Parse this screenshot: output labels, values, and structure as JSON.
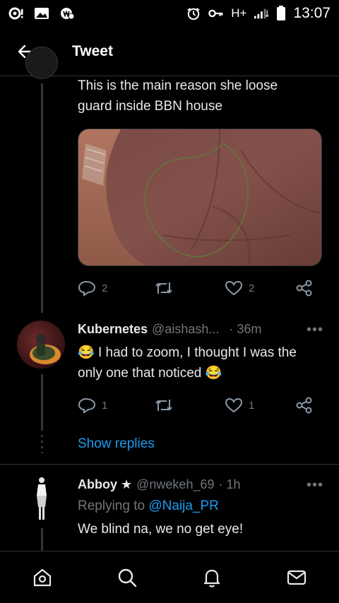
{
  "status_bar": {
    "time": "13:07",
    "network": "H+",
    "icons": [
      "notification-icon",
      "gallery-icon",
      "app-icon",
      "alarm-icon",
      "key-icon",
      "signal-icon",
      "battery-icon"
    ]
  },
  "app_bar": {
    "title": "Tweet"
  },
  "main_tweet": {
    "text_line1": "This is the main reason she loose",
    "text_line2": "guard inside BBN house",
    "replies": "2",
    "likes": "2"
  },
  "reply1": {
    "name": "Kubernetes",
    "handle": "@aishash...",
    "time": "· 36m",
    "text_line1": "I had to zoom, I thought I was the",
    "text_line2": "only one that noticed",
    "emoji": "😂",
    "replies": "1",
    "likes": "1",
    "show_replies": "Show replies"
  },
  "reply2": {
    "name": "Abboy",
    "star": "★",
    "handle": "@nwekeh_69",
    "time": "· 1h",
    "replying_prefix": "Replying to",
    "replying_to": "@Naija_PR",
    "text": "We blind na, we no get eye!"
  },
  "colors": {
    "background": "#000000",
    "text": "#e7e9ea",
    "muted": "#71767b",
    "link": "#1d9bf0",
    "divider": "#2f3336"
  },
  "bottom_nav": [
    "home-icon",
    "search-icon",
    "notifications-icon",
    "messages-icon"
  ]
}
